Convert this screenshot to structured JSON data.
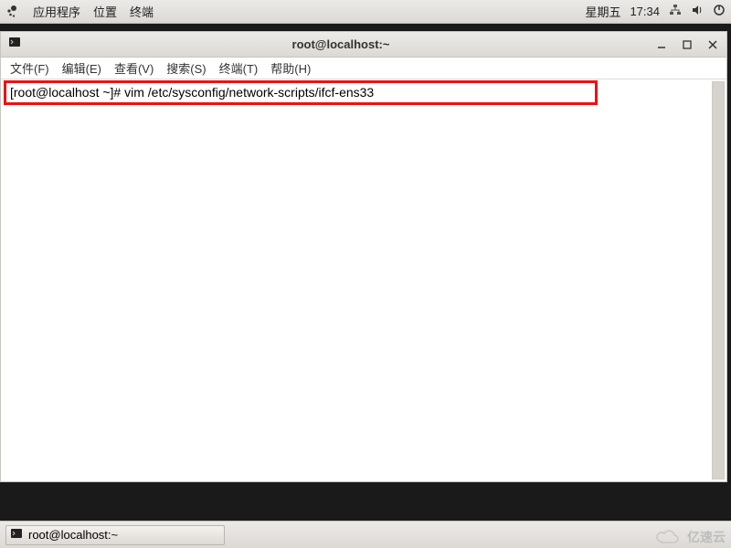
{
  "topbar": {
    "apps": "应用程序",
    "places": "位置",
    "terminal": "终端",
    "day": "星期五",
    "time": "17:34"
  },
  "window": {
    "title": "root@localhost:~"
  },
  "menubar": {
    "file": "文件(F)",
    "edit": "编辑(E)",
    "view": "查看(V)",
    "search": "搜索(S)",
    "terminal": "终端(T)",
    "help": "帮助(H)"
  },
  "terminal": {
    "prompt": "[root@localhost ~]# ",
    "command": "vim /etc/sysconfig/network-scripts/ifcf-ens33"
  },
  "taskbar": {
    "tab_label": "root@localhost:~"
  },
  "watermark": {
    "text": "亿速云"
  }
}
